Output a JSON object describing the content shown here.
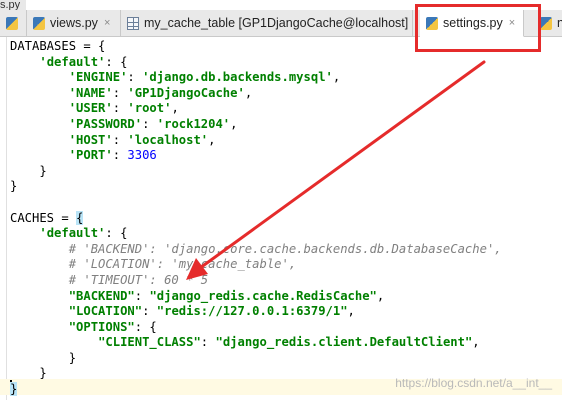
{
  "breadcrumb": "s.py",
  "tabs": [
    {
      "label": "",
      "icon": "python-file-icon",
      "active": false
    },
    {
      "label": "views.py",
      "icon": "python-file-icon",
      "active": false
    },
    {
      "label": "my_cache_table [GP1DjangoCache@localhost]",
      "icon": "database-table-icon",
      "active": false
    },
    {
      "label": "settings.py",
      "icon": "python-file-icon",
      "active": true
    },
    {
      "label": "ne",
      "icon": "python-file-icon",
      "active": false
    }
  ],
  "close_glyph": "×",
  "highlight_color": "#e52b2b",
  "code": {
    "l1": "DATABASES = {",
    "l2_key": "'default'",
    "l3_key": "'ENGINE'",
    "l3_val": "'django.db.backends.mysql'",
    "l4_key": "'NAME'",
    "l4_val": "'GP1DjangoCache'",
    "l5_key": "'USER'",
    "l5_val": "'root'",
    "l6_key": "'PASSWORD'",
    "l6_val": "'rock1204'",
    "l7_key": "'HOST'",
    "l7_val": "'localhost'",
    "l8_key": "'PORT'",
    "l8_val": "3306",
    "l12_a": "CACHES = ",
    "l12_brace": "{",
    "l13_key": "'default'",
    "l14": "# 'BACKEND': 'django.core.cache.backends.db.DatabaseCache',",
    "l15": "# 'LOCATION': 'my_cache_table',",
    "l16": "# 'TIMEOUT': 60 * 5",
    "l17_key": "\"BACKEND\"",
    "l17_val": "\"django_redis.cache.RedisCache\"",
    "l18_key": "\"LOCATION\"",
    "l18_val": "\"redis://127.0.0.1:6379/1\"",
    "l19_key": "\"OPTIONS\"",
    "l20_key": "\"CLIENT_CLASS\"",
    "l20_val": "\"django_redis.client.DefaultClient\"",
    "l24": "}"
  },
  "watermark": "https://blog.csdn.net/a__int__"
}
